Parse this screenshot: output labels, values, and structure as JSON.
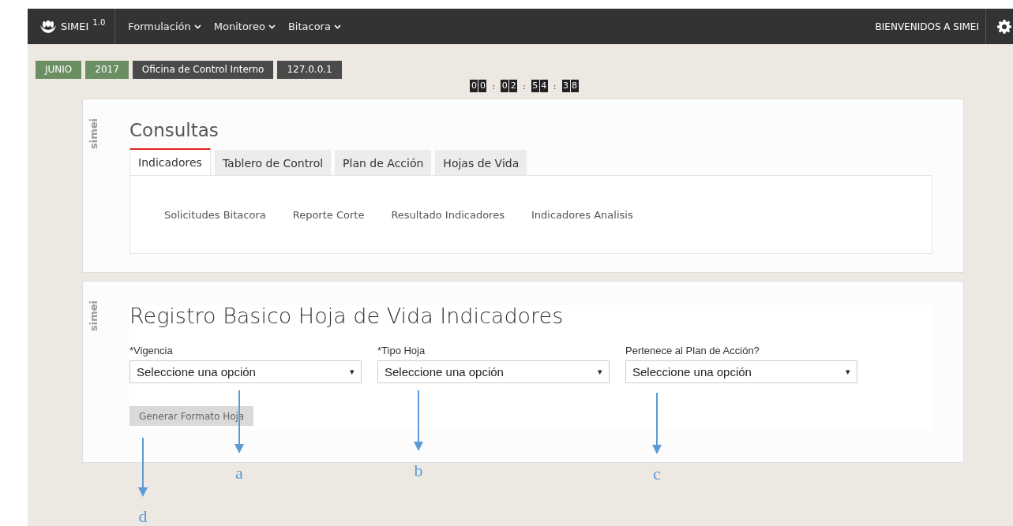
{
  "navbar": {
    "brand": "SIMEI",
    "version": "1.0",
    "menus": [
      "Formulación",
      "Monitoreo",
      "Bitacora"
    ],
    "welcome": "BIENVENIDOS A SIMEI"
  },
  "badges": [
    {
      "text": "JUNIO",
      "color": "#6b8f63"
    },
    {
      "text": "2017",
      "color": "#6b8f63"
    },
    {
      "text": "Oficina de Control Interno",
      "color": "#4a4a4a"
    },
    {
      "text": "127.0.0.1",
      "color": "#4a4a4a"
    }
  ],
  "timer": [
    [
      "0",
      "0"
    ],
    [
      "0",
      "2"
    ],
    [
      "5",
      "4"
    ],
    [
      "3",
      "8"
    ]
  ],
  "timer_separator": ":",
  "consultas": {
    "side_label": "simei",
    "title": "Consultas",
    "tabs": [
      {
        "label": "Indicadores",
        "selected": true
      },
      {
        "label": "Tablero de Control",
        "selected": false
      },
      {
        "label": "Plan de Acción",
        "selected": false
      },
      {
        "label": "Hojas de Vida",
        "selected": false
      }
    ],
    "links": [
      "Solicitudes Bitacora",
      "Reporte Corte",
      "Resultado Indicadores",
      "Indicadores Analisis"
    ]
  },
  "registro": {
    "side_label": "simei",
    "title": "Registro Basico Hoja de Vida Indicadores",
    "fields": [
      {
        "label": "*Vigencia",
        "value": "Seleccione una opción",
        "caret": "▾"
      },
      {
        "label": "*Tipo Hoja",
        "value": "Seleccione una opción",
        "caret": "▾"
      },
      {
        "label": "Pertenece al Plan de Acción?",
        "value": "Seleccione una opción",
        "caret": "▾"
      }
    ],
    "button": {
      "label": "Generar Formato Hoja",
      "disabled": true
    }
  },
  "annotations": [
    {
      "label": "a"
    },
    {
      "label": "b"
    },
    {
      "label": "c"
    },
    {
      "label": "d"
    }
  ]
}
